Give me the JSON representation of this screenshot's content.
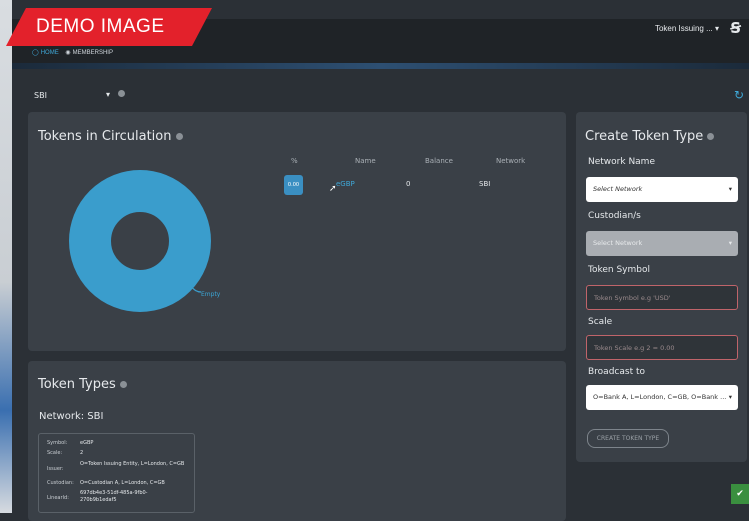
{
  "banner": {
    "text": "DEMO IMAGE"
  },
  "header": {
    "user_menu": "Token Issuing ...",
    "user_caret": "▾",
    "logo_glyph": "Ꞩ"
  },
  "nav": {
    "items": [
      {
        "icon": "home-icon",
        "label": "HOME"
      },
      {
        "icon": "membership-icon",
        "label": "MEMBERSHIP"
      }
    ]
  },
  "filter": {
    "network_value": "SBI",
    "caret": "▾"
  },
  "tokens_in_circulation": {
    "title": "Tokens in Circulation",
    "columns": [
      "%",
      "Name",
      "Balance",
      "Network"
    ],
    "rows": [
      {
        "pct": "0.00",
        "name": "eGBP",
        "balance": "0",
        "network": "SBI"
      }
    ],
    "donut_label": "Empty",
    "donut_color": "#3a9dcc"
  },
  "create_token_type": {
    "title": "Create Token Type",
    "network_name_label": "Network Name",
    "network_placeholder": "Select Network",
    "custodians_label": "Custodian/s",
    "custodians_placeholder": "Select Network",
    "token_symbol_label": "Token Symbol",
    "token_symbol_placeholder": "Token Symbol e.g 'USD'",
    "scale_label": "Scale",
    "scale_placeholder": "Token Scale e.g 2 = 0.00",
    "broadcast_label": "Broadcast to",
    "broadcast_value": "O=Bank A, L=London, C=GB, O=Bank ...",
    "submit": "CREATE TOKEN TYPE"
  },
  "token_types": {
    "title": "Token Types",
    "network": "Network: SBI",
    "item": {
      "symbol_key": "Symbol:",
      "symbol": "eGBP",
      "scale_key": "Scale:",
      "scale": "2",
      "issuer_key": "Issuer:",
      "issuer": "O=Token Issuing Entity, L=London, C=GB",
      "custodian_key": "Custodian:",
      "custodian": "O=Custodian A, L=London, C=GB",
      "linearid_key": "LinearId:",
      "linearid": "697db4e3-51df-485a-9fb0-270b9b1edaf5"
    }
  },
  "colors": {
    "accent": "#3fa8d8",
    "banner": "#e3212b",
    "success": "#3a8f3f"
  }
}
